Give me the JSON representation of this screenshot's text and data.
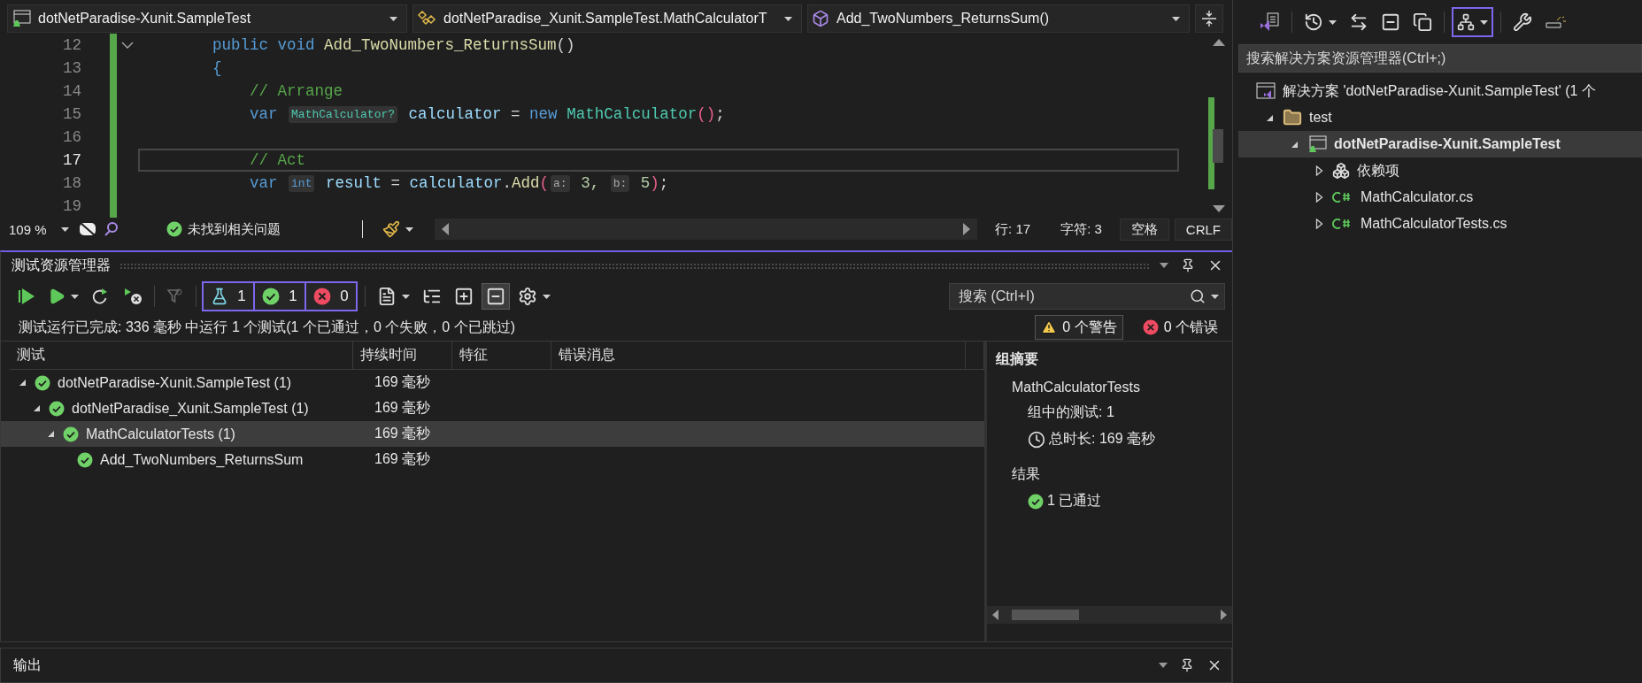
{
  "editor": {
    "nav": [
      {
        "kind": "project",
        "text": "dotNetParadise-Xunit.SampleTest"
      },
      {
        "kind": "class",
        "text": "dotNetParadise_Xunit.SampleTest.MathCalculatorT"
      },
      {
        "kind": "method",
        "text": "Add_TwoNumbers_ReturnsSum()"
      }
    ],
    "lines": [
      {
        "number": "12",
        "current": false,
        "changed": true,
        "foldable": true,
        "tokens": [
          {
            "text": "    public void ",
            "kind": "keyword"
          },
          {
            "text": "Add_TwoNumbers_ReturnsSum",
            "kind": "method"
          },
          {
            "text": "()",
            "kind": "plain"
          }
        ]
      },
      {
        "number": "13",
        "current": false,
        "changed": true,
        "foldable": false,
        "tokens": [
          {
            "text": "    {",
            "kind": "keyword"
          }
        ]
      },
      {
        "number": "14",
        "current": false,
        "changed": true,
        "foldable": false,
        "tokens": [
          {
            "text": "        // Arrange",
            "kind": "comment"
          }
        ]
      },
      {
        "number": "15",
        "current": false,
        "changed": true,
        "foldable": false,
        "tokens": [
          {
            "text": "        var ",
            "kind": "keyword"
          },
          {
            "text": "MathCalculator?",
            "kind": "hint-type"
          },
          {
            "text": " calculator",
            "kind": "variable"
          },
          {
            "text": " = ",
            "kind": "plain"
          },
          {
            "text": "new ",
            "kind": "keyword"
          },
          {
            "text": "MathCalculator",
            "kind": "type"
          },
          {
            "text": "()",
            "kind": "bracket"
          },
          {
            "text": ";",
            "kind": "plain"
          }
        ]
      },
      {
        "number": "16",
        "current": false,
        "changed": true,
        "foldable": false
      },
      {
        "number": "17",
        "current": true,
        "changed": true,
        "foldable": false,
        "tokens": [
          {
            "text": "        // Act",
            "kind": "comment"
          }
        ]
      },
      {
        "number": "18",
        "current": false,
        "changed": true,
        "foldable": false,
        "tokens": [
          {
            "text": "        var ",
            "kind": "keyword"
          },
          {
            "text": "int",
            "kind": "hint-keyword"
          },
          {
            "text": " result",
            "kind": "variable"
          },
          {
            "text": " = ",
            "kind": "plain"
          },
          {
            "text": "calculator",
            "kind": "variable"
          },
          {
            "text": ".",
            "kind": "plain"
          },
          {
            "text": "Add",
            "kind": "method"
          },
          {
            "text": "(",
            "kind": "bracket"
          },
          {
            "text": "a:",
            "kind": "hint"
          },
          {
            "text": " 3, ",
            "kind": "number"
          },
          {
            "text": "b:",
            "kind": "hint"
          },
          {
            "text": " 5",
            "kind": "number"
          },
          {
            "text": ")",
            "kind": "bracket"
          },
          {
            "text": ";",
            "kind": "plain"
          }
        ]
      },
      {
        "number": "19",
        "current": false,
        "changed": true,
        "foldable": false
      }
    ],
    "status": {
      "zoom": "109 %",
      "issues": "未找到相关问题",
      "line": "行: 17",
      "char": "字符: 3",
      "spacing": "空格",
      "line_ending": "CRLF"
    }
  },
  "test_explorer": {
    "title": "测试资源管理器",
    "toolbar_left": [
      {
        "kind": "run-all",
        "menu": false,
        "disabled": false
      },
      {
        "kind": "run",
        "menu": true,
        "disabled": false
      },
      {
        "kind": "rerun",
        "menu": false,
        "disabled": false
      },
      {
        "kind": "cancel",
        "menu": false,
        "disabled": false
      },
      {
        "kind": "filter",
        "menu": false,
        "disabled": true
      }
    ],
    "counters": [
      {
        "kind": "total",
        "count": "1",
        "selected": true
      },
      {
        "kind": "passed",
        "count": "1",
        "selected": true
      },
      {
        "kind": "failed",
        "count": "0",
        "selected": true
      }
    ],
    "toolbar_right": [
      {
        "kind": "playlist",
        "menu": true,
        "selected": false
      },
      {
        "kind": "hierarchy",
        "menu": false,
        "selected": false
      },
      {
        "kind": "expand",
        "menu": false,
        "selected": false
      },
      {
        "kind": "collapse",
        "menu": false,
        "selected": true
      },
      {
        "kind": "settings",
        "menu": true,
        "selected": false
      }
    ],
    "search": {
      "placeholder": "搜索 (Ctrl+I)"
    },
    "summary": "测试运行已完成: 336 毫秒 中运行 1 个测试(1 个已通过，0 个失败，0 个已跳过)",
    "warnings": "0 个警告",
    "errors": "0 个错误",
    "columns": [
      "测试",
      "持续时间",
      "特征",
      "错误消息"
    ],
    "tests": [
      {
        "name": "dotNetParadise-Xunit.SampleTest  (1)",
        "duration": "169 毫秒",
        "passed": true,
        "expanded": true,
        "selected": false,
        "children": [
          {
            "name": "dotNetParadise_Xunit.SampleTest  (1)",
            "duration": "169 毫秒",
            "passed": true,
            "expanded": true,
            "selected": false,
            "children": [
              {
                "name": "MathCalculatorTests  (1)",
                "duration": "169 毫秒",
                "passed": true,
                "expanded": true,
                "selected": true,
                "children": [
                  {
                    "name": "Add_TwoNumbers_ReturnsSum",
                    "duration": "169 毫秒",
                    "passed": true,
                    "selected": false
                  }
                ]
              }
            ]
          }
        ]
      }
    ],
    "group_summary": {
      "title": "组摘要",
      "group": "MathCalculatorTests",
      "tests_in_group": "组中的测试: 1",
      "total_duration": "总时长: 169  毫秒",
      "results_title": "结果",
      "results": [
        {
          "passed": true,
          "text": "1 已通过"
        }
      ]
    }
  },
  "output": {
    "title": "输出"
  },
  "solution_explorer": {
    "toolbar": [
      {
        "kind": "switch-views",
        "menu": false,
        "selected": false
      },
      {
        "kind": "pending-changes",
        "menu": true,
        "selected": false
      },
      {
        "kind": "sync",
        "menu": false,
        "selected": false
      },
      {
        "kind": "collapse-all",
        "menu": false,
        "selected": false
      },
      {
        "kind": "show-all",
        "menu": false,
        "selected": false
      },
      {
        "kind": "tree-view",
        "menu": true,
        "selected": true
      },
      {
        "kind": "properties",
        "menu": false,
        "selected": false
      },
      {
        "kind": "preview",
        "menu": false,
        "selected": false
      }
    ],
    "search": {
      "placeholder": "搜索解决方案资源管理器(Ctrl+;)"
    },
    "tree": [
      {
        "kind": "solution",
        "label": "解决方案 'dotNetParadise-Xunit.SampleTest' (1 个",
        "selected": false,
        "children": [
          {
            "kind": "folder",
            "label": "test",
            "expanded": true,
            "selected": false,
            "children": [
              {
                "kind": "project",
                "label": "dotNetParadise-Xunit.SampleTest",
                "expanded": true,
                "selected": true,
                "children": [
                  {
                    "kind": "dependencies",
                    "label": "依赖项",
                    "expanded": false,
                    "selected": false
                  },
                  {
                    "kind": "csharp",
                    "label": "MathCalculator.cs",
                    "expanded": false,
                    "selected": false
                  },
                  {
                    "kind": "csharp",
                    "label": "MathCalculatorTests.cs",
                    "expanded": false,
                    "selected": false
                  }
                ]
              }
            ]
          }
        ]
      }
    ]
  }
}
